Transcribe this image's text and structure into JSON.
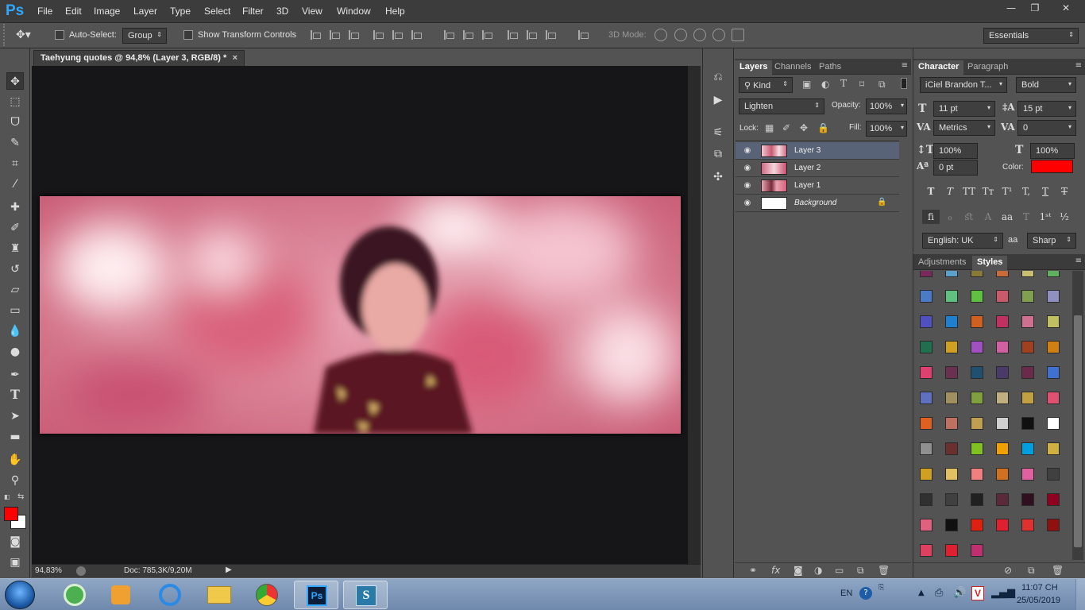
{
  "app": {
    "logo": "Ps"
  },
  "menu": [
    "File",
    "Edit",
    "Image",
    "Layer",
    "Type",
    "Select",
    "Filter",
    "3D",
    "View",
    "Window",
    "Help"
  ],
  "window_controls": {
    "minimize": "—",
    "restore": "❐",
    "close": "✕"
  },
  "options_bar": {
    "auto_select_label": "Auto-Select:",
    "auto_select_value": "Group",
    "transform_controls_label": "Show Transform Controls",
    "mode_3d_label": "3D Mode:",
    "workspace": "Essentials"
  },
  "document": {
    "tab_title": "Taehyung quotes @ 94,8% (Layer 3, RGB/8) *",
    "tab_close": "×",
    "zoom": "94,83%",
    "doc_info": "Doc: 785,3K/9,20M"
  },
  "colors": {
    "foreground": "#ff0000",
    "background": "#ffffff",
    "accent": "#31a8ff"
  },
  "layers_panel": {
    "tabs": [
      "Layers",
      "Channels",
      "Paths"
    ],
    "filter_kind": "Kind",
    "blend_mode": "Lighten",
    "opacity_label": "Opacity:",
    "opacity": "100%",
    "lock_label": "Lock:",
    "fill_label": "Fill:",
    "fill": "100%",
    "layers": [
      {
        "name": "Layer 3",
        "selected": true
      },
      {
        "name": "Layer 2",
        "selected": false
      },
      {
        "name": "Layer 1",
        "selected": false
      },
      {
        "name": "Background",
        "selected": false,
        "locked": true
      }
    ],
    "footer_icons": [
      "link-icon",
      "fx-icon",
      "mask-icon",
      "adjustment-icon",
      "group-icon",
      "new-layer-icon",
      "trash-icon"
    ],
    "fx_label": "fx"
  },
  "character_panel": {
    "tabs": [
      "Character",
      "Paragraph"
    ],
    "font_family": "iCiel Brandon T...",
    "font_style": "Bold",
    "font_size": "11 pt",
    "leading": "15 pt",
    "kerning": "Metrics",
    "tracking": "0",
    "vertical_scale": "100%",
    "horizontal_scale": "100%",
    "baseline_shift": "0 pt",
    "color_label": "Color:",
    "color": "#ff0000",
    "language": "English: UK",
    "antialias_label": "aa",
    "antialias": "Sharp"
  },
  "styles_panel": {
    "tabs": [
      "Adjustments",
      "Styles"
    ],
    "swatches": [
      "#7a2a5a",
      "#5aa0c8",
      "#8a7a3a",
      "#c86a3a",
      "#c8c070",
      "#60b060",
      "#4a7ac8",
      "#60c080",
      "#60c040",
      "#c85a6a",
      "#80a050",
      "#9090c0",
      "#5050c0",
      "#2080d0",
      "#d06020",
      "#c03060",
      "#d07090",
      "#c0c060",
      "#207050",
      "#d0a020",
      "#a050c0",
      "#d060a0",
      "#a04020",
      "#d08010",
      "#e04070",
      "#6a3050",
      "#205070",
      "#4a3a6a",
      "#6a2a4a",
      "#4070d0",
      "#6070c0",
      "#a09060",
      "#80a040",
      "#c0b080",
      "#c0a040",
      "#e05070",
      "#e06020",
      "#c07060",
      "#c0a050",
      "#d0d0d0",
      "#101010",
      "#ffffff",
      "#909090",
      "#6a3030",
      "#80c020",
      "#f0a000",
      "#00a0e0",
      "#d0b040",
      "#d0a020",
      "#e0c060",
      "#f08080",
      "#d07020",
      "#e060a0",
      "#404040",
      "#303030",
      "#404040",
      "#202020",
      "#5a2a3a",
      "#301020",
      "#900020",
      "#e06080",
      "#101010",
      "#e02010",
      "#e02030",
      "#e03030",
      "#901010",
      "#e04060",
      "#e02030",
      "#c03070"
    ]
  },
  "taskbar": {
    "apps": [
      "windows-start",
      "coccoc",
      "media-player",
      "internet-explorer",
      "file-explorer",
      "chrome",
      "photoshop",
      "sai"
    ],
    "language": "EN",
    "help_icon": "?",
    "time": "11:07 CH",
    "date": "25/05/2019"
  }
}
